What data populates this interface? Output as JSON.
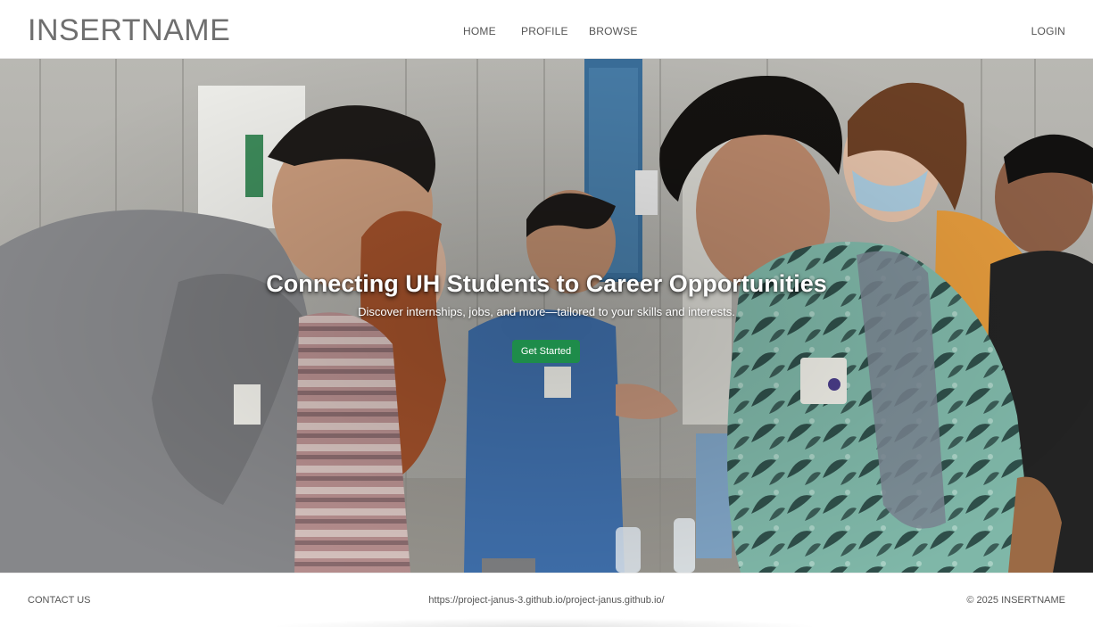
{
  "navbar": {
    "brand": "INSERTNAME",
    "links": {
      "home": "HOME",
      "profile": "PROFILE",
      "browse": "BROWSE"
    },
    "login": "LOGIN"
  },
  "hero": {
    "title": "Connecting UH Students to Career Opportunities",
    "subtitle": "Discover internships, jobs, and more—tailored to your skills and interests.",
    "cta_label": "Get Started",
    "cta_color": "#1e8c4a",
    "image_description_icon": "career-fair-photo"
  },
  "footer": {
    "contact": "CONTACT US",
    "url": "https://project-janus-3.github.io/project-janus.github.io/",
    "copyright": "© 2025 INSERTNAME"
  },
  "colors": {
    "brand_text": "#6f6f6f",
    "nav_text": "#555555",
    "accent": "#1e8c4a"
  }
}
